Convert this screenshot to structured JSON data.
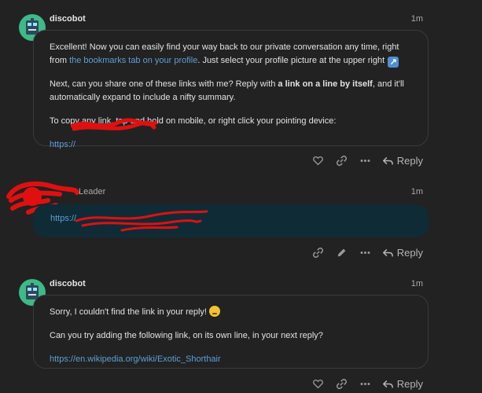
{
  "posts": [
    {
      "author": "discobot",
      "time": "1m",
      "paragraph1_before": "Excellent! Now you can easily find your way back to our private conversation any time, right from ",
      "paragraph1_link": "the bookmarks tab on your profile",
      "paragraph1_after": ". Just select your profile picture at the upper right",
      "paragraph2_before": "Next, can you share one of these links with me? Reply with ",
      "paragraph2_bold": "a link on a line by itself",
      "paragraph2_after": ", and it'll automatically expand to include a nifty summary.",
      "paragraph3": "To copy any link, tap and hold on mobile, or right click your pointing device:",
      "link": "https://",
      "reply_label": "Reply"
    },
    {
      "author_suffix": "Leader",
      "time": "1m",
      "link": "https://",
      "reply_label": "Reply"
    },
    {
      "author": "discobot",
      "time": "1m",
      "paragraph1": "Sorry, I couldn't find the link in your reply!",
      "paragraph2": "Can you try adding the following link, on its own line, in your next reply?",
      "link": "https://en.wikipedia.org/wiki/Exotic_Shorthair",
      "reply_label": "Reply"
    }
  ],
  "icons": {
    "like": "heart-icon",
    "copy_link": "link-icon",
    "more": "more-icon",
    "edit": "pencil-icon",
    "reply": "reply-icon"
  },
  "colors": {
    "background": "#222222",
    "link": "#5e9fd2",
    "user_bubble": "#0f2b36",
    "avatar": "#3dba86"
  }
}
